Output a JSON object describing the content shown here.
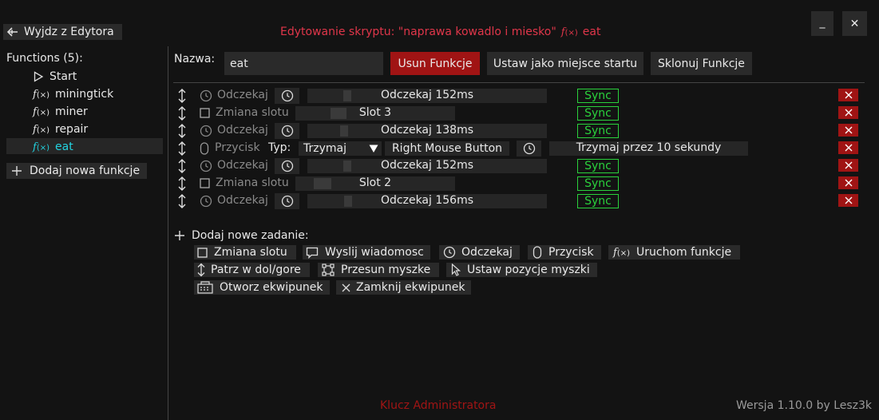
{
  "header": {
    "back_label": "Wyjdz z Edytora",
    "title_prefix": "Edytowanie skryptu: \"naprawa kowadlo i miesko\"",
    "title_fx": "f",
    "title_fx_sub": "(×)",
    "title_func": "eat",
    "minimize": "_",
    "close": "✕"
  },
  "sidebar": {
    "heading": "Functions (5):",
    "items": [
      {
        "label": "Start",
        "icon": "play-icon"
      },
      {
        "label": "miningtick",
        "icon": "function-icon"
      },
      {
        "label": "miner",
        "icon": "function-icon"
      },
      {
        "label": "repair",
        "icon": "function-icon"
      },
      {
        "label": "eat",
        "icon": "function-icon",
        "selected": true
      }
    ],
    "add_label": "Dodaj nowa funkcje"
  },
  "name_bar": {
    "label": "Nazwa:",
    "value": "eat",
    "delete": "Usun Funkcje",
    "set_start": "Ustaw jako miejsce startu",
    "clone": "Sklonuj Funkcje"
  },
  "tasks": [
    {
      "type": "Odczekaj",
      "value": "Odczekaj 152ms",
      "sync": "Sync"
    },
    {
      "type": "Zmiana slotu",
      "value": "Slot 3",
      "sync": "Sync"
    },
    {
      "type": "Odczekaj",
      "value": "Odczekaj 138ms",
      "sync": "Sync"
    },
    {
      "type": "Przycisk",
      "typ_label": "Typ:",
      "mode": "Trzymaj",
      "key": "Right Mouse Button",
      "value": "Trzymaj przez 10 sekundy"
    },
    {
      "type": "Odczekaj",
      "value": "Odczekaj 152ms",
      "sync": "Sync"
    },
    {
      "type": "Zmiana slotu",
      "value": "Slot 2",
      "sync": "Sync"
    },
    {
      "type": "Odczekaj",
      "value": "Odczekaj 156ms",
      "sync": "Sync"
    }
  ],
  "add_task": {
    "label": "Dodaj nowe zadanie:",
    "options": [
      {
        "label": "Zmiana slotu",
        "icon": "checkbox-icon"
      },
      {
        "label": "Wyslij wiadomosc",
        "icon": "chat-icon"
      },
      {
        "label": "Odczekaj",
        "icon": "clock-icon"
      },
      {
        "label": "Przycisk",
        "icon": "mouse-icon"
      },
      {
        "label": "Uruchom funkcje",
        "icon": "function-icon"
      },
      {
        "label": "Patrz w dol/gore",
        "icon": "vertical-arrows-icon"
      },
      {
        "label": "Przesun myszke",
        "icon": "move-icon"
      },
      {
        "label": "Ustaw pozycje myszki",
        "icon": "cursor-icon"
      },
      {
        "label": "Otworz ekwipunek",
        "icon": "inventory-icon"
      },
      {
        "label": "Zamknij ekwipunek",
        "icon": "close-icon"
      }
    ]
  },
  "footer": {
    "admin_key": "Klucz Administratora",
    "version": "Wersja 1.10.0 by Lesz3k"
  },
  "colors": {
    "accent_red": "#e0364a",
    "delete_red": "#a01414",
    "sync_green": "#2ad13c",
    "selected_cyan": "#22d3e0"
  }
}
